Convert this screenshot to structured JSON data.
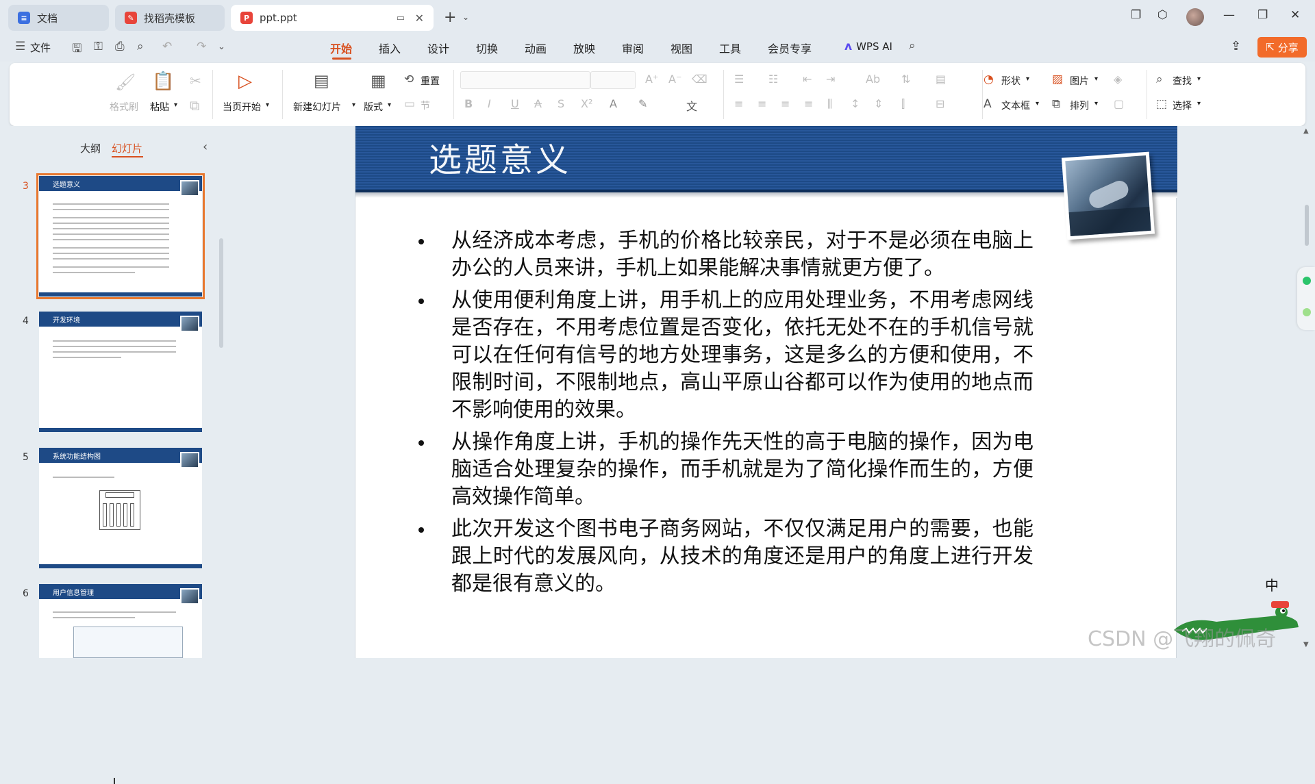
{
  "tabs": [
    {
      "label": "文档",
      "icon": "docs-icon",
      "color": "#3b6fe0"
    },
    {
      "label": "找稻壳模板",
      "icon": "docer-icon",
      "color": "#e8443a"
    },
    {
      "label": "ppt.ppt",
      "icon": "ppt-icon",
      "color": "#e8443a"
    }
  ],
  "menu": {
    "file_label": "文件",
    "items": [
      "开始",
      "插入",
      "设计",
      "切换",
      "动画",
      "放映",
      "审阅",
      "视图",
      "工具",
      "会员专享"
    ],
    "active": "开始",
    "wps_ai": "WPS AI",
    "share": "分享"
  },
  "ribbon": {
    "format_painter": "格式刷",
    "paste": "粘贴",
    "play_from_current": "当页开始",
    "new_slide": "新建幻灯片",
    "layout": "版式",
    "reset": "重置",
    "section": "节",
    "shape": "形状",
    "picture": "图片",
    "textbox": "文本框",
    "arrange": "排列",
    "find": "查找",
    "select": "选择"
  },
  "left_panel": {
    "outline_tab": "大纲",
    "slides_tab": "幻灯片",
    "thumbnails": [
      {
        "num": "3",
        "title": "选题意义",
        "selected": true
      },
      {
        "num": "4",
        "title": "开发环境",
        "selected": false
      },
      {
        "num": "5",
        "title": "系统功能结构图",
        "selected": false
      },
      {
        "num": "6",
        "title": "用户信息管理",
        "selected": false
      }
    ]
  },
  "slide": {
    "title": "选题意义",
    "bullets": [
      "从经济成本考虑，手机的价格比较亲民，对于不是必须在电脑上办公的人员来讲，手机上如果能解决事情就更方便了。",
      "从使用便利角度上讲，用手机上的应用处理业务，不用考虑网线是否存在，不用考虑位置是否变化，依托无处不在的手机信号就可以在任何有信号的地方处理事务，这是多么的方便和使用，不限制时间，不限制地点，高山平原山谷都可以作为使用的地点而不影响使用的效果。",
      "从操作角度上讲，手机的操作先天性的高于电脑的操作，因为电脑适合处理复杂的操作，而手机就是为了简化操作而生的，方便高效操作简单。",
      "此次开发这个图书电子商务网站，不仅仅满足用户的需要，也能跟上时代的发展风向，从技术的角度还是用户的角度上进行开发都是很有意义的。"
    ]
  },
  "watermark": "CSDN @飞翔的佩奇",
  "ime_indicator": "中",
  "colors": {
    "accent": "#d8501f",
    "slide_header": "#1d4a86",
    "share_button": "#f26b2a"
  }
}
